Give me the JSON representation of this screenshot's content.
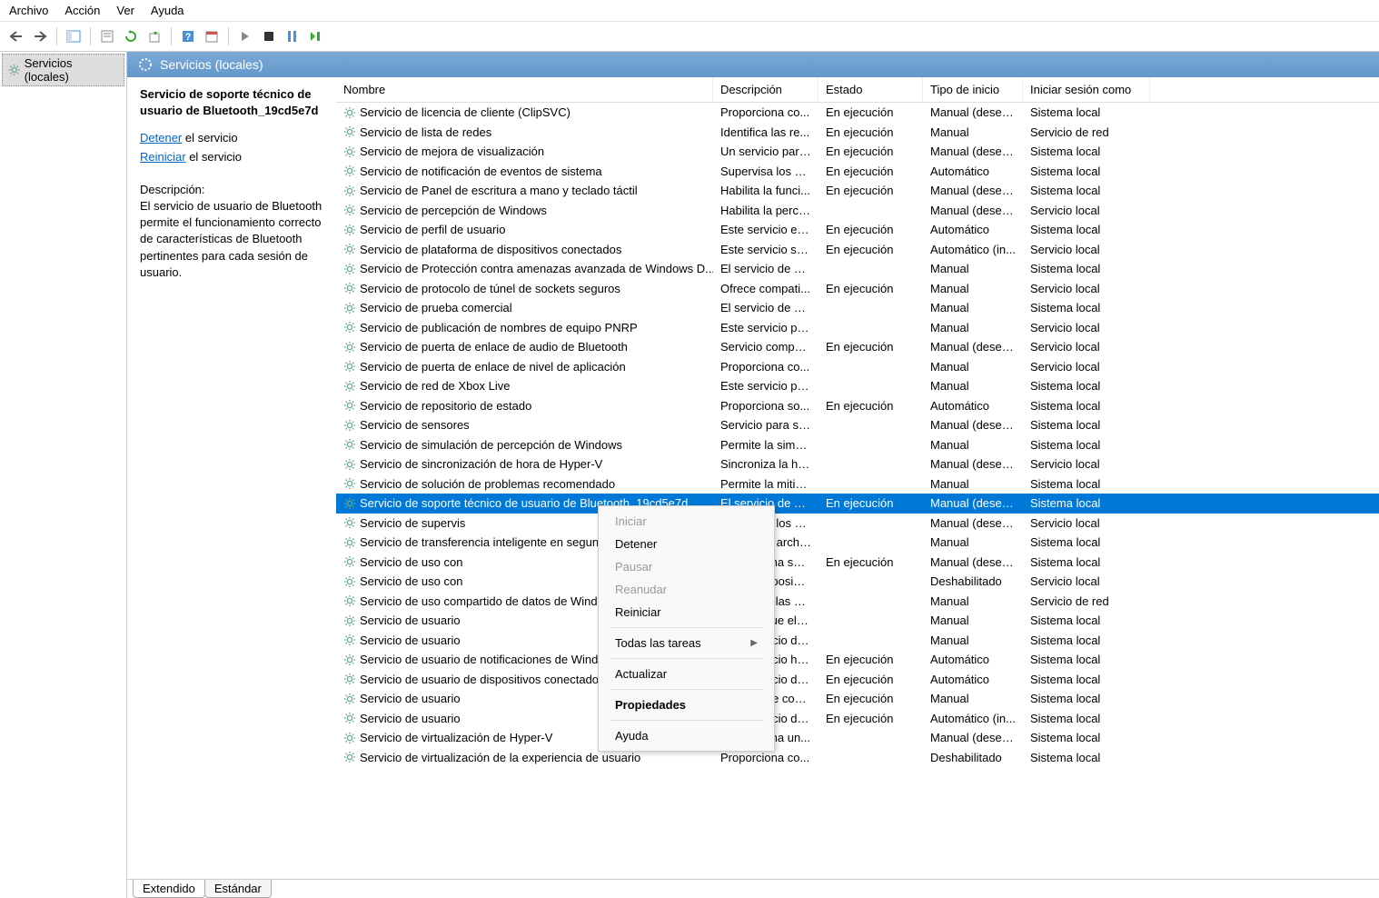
{
  "menubar": {
    "items": [
      "Archivo",
      "Acción",
      "Ver",
      "Ayuda"
    ]
  },
  "tree": {
    "root": "Servicios (locales)"
  },
  "header": {
    "title": "Servicios (locales)"
  },
  "detail": {
    "title": "Servicio de soporte técnico de usuario de Bluetooth_19cd5e7d",
    "stop_link": "Detener",
    "stop_after": " el servicio",
    "restart_link": "Reiniciar",
    "restart_after": " el servicio",
    "desc_label": "Descripción:",
    "desc_text": "El servicio de usuario de Bluetooth permite el funcionamiento correcto de características de Bluetooth pertinentes para cada sesión de usuario."
  },
  "columns": {
    "name": "Nombre",
    "desc": "Descripción",
    "state": "Estado",
    "start": "Tipo de inicio",
    "logon": "Iniciar sesión como"
  },
  "services": [
    {
      "name": "Servicio de licencia de cliente (ClipSVC)",
      "desc": "Proporciona co...",
      "state": "En ejecución",
      "start": "Manual (desen...",
      "logon": "Sistema local"
    },
    {
      "name": "Servicio de lista de redes",
      "desc": "Identifica las re...",
      "state": "En ejecución",
      "start": "Manual",
      "logon": "Servicio de red"
    },
    {
      "name": "Servicio de mejora de visualización",
      "desc": "Un servicio para...",
      "state": "En ejecución",
      "start": "Manual (desen...",
      "logon": "Sistema local"
    },
    {
      "name": "Servicio de notificación de eventos de sistema",
      "desc": "Supervisa los ev...",
      "state": "En ejecución",
      "start": "Automático",
      "logon": "Sistema local"
    },
    {
      "name": "Servicio de Panel de escritura a mano y teclado táctil",
      "desc": "Habilita la funci...",
      "state": "En ejecución",
      "start": "Manual (desen...",
      "logon": "Sistema local"
    },
    {
      "name": "Servicio de percepción de Windows",
      "desc": "Habilita la perce...",
      "state": "",
      "start": "Manual (desen...",
      "logon": "Servicio local"
    },
    {
      "name": "Servicio de perfil de usuario",
      "desc": "Este servicio es r...",
      "state": "En ejecución",
      "start": "Automático",
      "logon": "Sistema local"
    },
    {
      "name": "Servicio de plataforma de dispositivos conectados",
      "desc": "Este servicio se ...",
      "state": "En ejecución",
      "start": "Automático (in...",
      "logon": "Servicio local"
    },
    {
      "name": "Servicio de Protección contra amenazas avanzada de Windows D...",
      "desc": "El servicio de Pr...",
      "state": "",
      "start": "Manual",
      "logon": "Sistema local"
    },
    {
      "name": "Servicio de protocolo de túnel de sockets seguros",
      "desc": "Ofrece compati...",
      "state": "En ejecución",
      "start": "Manual",
      "logon": "Servicio local"
    },
    {
      "name": "Servicio de prueba comercial",
      "desc": "El servicio de pr...",
      "state": "",
      "start": "Manual",
      "logon": "Sistema local"
    },
    {
      "name": "Servicio de publicación de nombres de equipo PNRP",
      "desc": "Este servicio pu...",
      "state": "",
      "start": "Manual",
      "logon": "Servicio local"
    },
    {
      "name": "Servicio de puerta de enlace de audio de Bluetooth",
      "desc": "Servicio compat...",
      "state": "En ejecución",
      "start": "Manual (desen...",
      "logon": "Servicio local"
    },
    {
      "name": "Servicio de puerta de enlace de nivel de aplicación",
      "desc": "Proporciona co...",
      "state": "",
      "start": "Manual",
      "logon": "Servicio local"
    },
    {
      "name": "Servicio de red de Xbox Live",
      "desc": "Este servicio pre...",
      "state": "",
      "start": "Manual",
      "logon": "Sistema local"
    },
    {
      "name": "Servicio de repositorio de estado",
      "desc": "Proporciona so...",
      "state": "En ejecución",
      "start": "Automático",
      "logon": "Sistema local"
    },
    {
      "name": "Servicio de sensores",
      "desc": "Servicio para se...",
      "state": "",
      "start": "Manual (desen...",
      "logon": "Sistema local"
    },
    {
      "name": "Servicio de simulación de percepción de Windows",
      "desc": "Permite la simul...",
      "state": "",
      "start": "Manual",
      "logon": "Sistema local"
    },
    {
      "name": "Servicio de sincronización de hora de Hyper-V",
      "desc": "Sincroniza la ho...",
      "state": "",
      "start": "Manual (desen...",
      "logon": "Servicio local"
    },
    {
      "name": "Servicio de solución de problemas recomendado",
      "desc": "Permite la mitig...",
      "state": "",
      "start": "Manual",
      "logon": "Sistema local"
    },
    {
      "name": "Servicio de soporte técnico de usuario de Bluetooth_19cd5e7d",
      "desc": "El servicio de us...",
      "state": "En ejecución",
      "start": "Manual (desen...",
      "logon": "Sistema local",
      "selected": true
    },
    {
      "name": "Servicio de supervis",
      "desc": "Supervisa los di...",
      "state": "",
      "start": "Manual (desen...",
      "logon": "Servicio local"
    },
    {
      "name": "Servicio de transferencia inteligente en segundo plano (BITS)",
      "desc": "Transfiere archiv...",
      "state": "",
      "start": "Manual",
      "logon": "Sistema local"
    },
    {
      "name": "Servicio de uso con",
      "desc": "Proporciona ser...",
      "state": "En ejecución",
      "start": "Manual (desen...",
      "logon": "Sistema local"
    },
    {
      "name": "Servicio de uso con",
      "desc": "Ofrece la posibil...",
      "state": "",
      "start": "Deshabilitado",
      "logon": "Servicio local"
    },
    {
      "name": "Servicio de uso compartido de datos de Windows ...",
      "desc": "Comparte las bi...",
      "state": "",
      "start": "Manual",
      "logon": "Servicio de red"
    },
    {
      "name": "Servicio de usuario",
      "desc": "Permite que el s...",
      "state": "",
      "start": "Manual",
      "logon": "Sistema local"
    },
    {
      "name": "Servicio de usuario",
      "desc": "Este servicio de ...",
      "state": "",
      "start": "Manual",
      "logon": "Sistema local"
    },
    {
      "name": "Servicio de usuario de notificaciones de Windows_1...",
      "desc": "Este servicio ho...",
      "state": "En ejecución",
      "start": "Automático",
      "logon": "Sistema local"
    },
    {
      "name": "Servicio de usuario de dispositivos conectados_19...",
      "desc": "Este servicio de ...",
      "state": "En ejecución",
      "start": "Automático",
      "logon": "Sistema local"
    },
    {
      "name": "Servicio de usuario",
      "desc": "Servicio de com...",
      "state": "En ejecución",
      "start": "Manual",
      "logon": "Sistema local"
    },
    {
      "name": "Servicio de usuario",
      "desc": "Este servicio de ...",
      "state": "En ejecución",
      "start": "Automático (in...",
      "logon": "Sistema local"
    },
    {
      "name": "Servicio de virtualización de Hyper-V",
      "desc": "Proporciona un...",
      "state": "",
      "start": "Manual (desen...",
      "logon": "Sistema local"
    },
    {
      "name": "Servicio de virtualización de la experiencia de usuario",
      "desc": "Proporciona co...",
      "state": "",
      "start": "Deshabilitado",
      "logon": "Sistema local"
    }
  ],
  "context_menu": {
    "items": [
      {
        "label": "Iniciar",
        "disabled": true
      },
      {
        "label": "Detener"
      },
      {
        "label": "Pausar",
        "disabled": true
      },
      {
        "label": "Reanudar",
        "disabled": true
      },
      {
        "label": "Reiniciar"
      },
      {
        "sep": true
      },
      {
        "label": "Todas las tareas",
        "submenu": true
      },
      {
        "sep": true
      },
      {
        "label": "Actualizar"
      },
      {
        "sep": true
      },
      {
        "label": "Propiedades",
        "bold": true
      },
      {
        "sep": true
      },
      {
        "label": "Ayuda"
      }
    ]
  },
  "tabs": {
    "extended": "Extendido",
    "standard": "Estándar"
  }
}
